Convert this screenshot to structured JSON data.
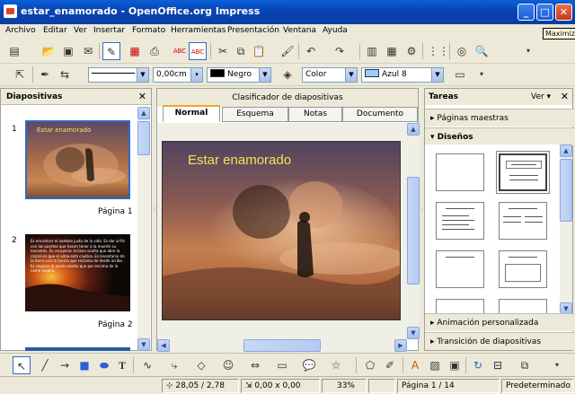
{
  "window": {
    "title": "estar_enamorado - OpenOffice.org Impress",
    "tooltip": "Maximizar",
    "minimize": "_",
    "maximize": "□",
    "close": "✕"
  },
  "menu": [
    "Archivo",
    "Editar",
    "Ver",
    "Insertar",
    "Formato",
    "Herramientas",
    "Presentación",
    "Ventana",
    "Ayuda"
  ],
  "toolbar2": {
    "line_width": "0,00cm",
    "line_color": "Negro",
    "line_color_hex": "#000000",
    "fill_type": "Color",
    "fill_color": "Azul 8",
    "fill_color_hex": "#99ccff"
  },
  "slides_panel": {
    "title": "Diapositivas",
    "close": "✕",
    "slides": [
      {
        "number": "1",
        "label": "Página 1",
        "title_text": "Estar enamorado"
      },
      {
        "number": "2",
        "label": "Página 2",
        "body_text": "Es encontrar el nombre justo de la vida. Es dar al fin con las puertas que hacen tener a la muerte su encantos. Es recuperar la llave oculta que abre la cárcel en que el alma está cautiva. Es levantarse de la tierra con la fuerza que reclama de desde arriba. Es respirar el ancho viento que por encima de la carne respira."
      }
    ]
  },
  "center": {
    "header": "Clasificador de diapositivas",
    "tabs": [
      "Normal",
      "Esquema",
      "Notas",
      "Documento"
    ],
    "slide_title": "Estar enamorado"
  },
  "tasks_panel": {
    "title": "Tareas",
    "view": "Ver ▾",
    "close": "✕",
    "sections": {
      "master": "Páginas maestras",
      "layouts": "Diseños",
      "animation": "Animación personalizada",
      "transition": "Transición de diapositivas"
    }
  },
  "status": {
    "position": "28,05 / 2,78",
    "size": "0,00 x 0,00",
    "zoom": "33%",
    "page": "Página 1 / 14",
    "master": "Predeterminado"
  }
}
